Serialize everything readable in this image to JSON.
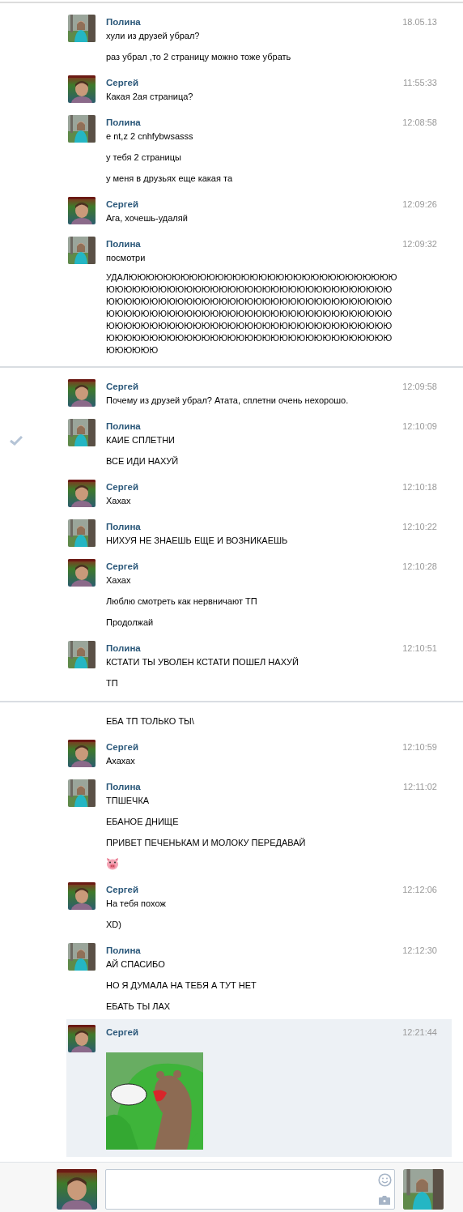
{
  "sections": [
    {
      "messages": [
        {
          "kind": "girl",
          "author": "Полина",
          "time": "18.05.13",
          "marked": false,
          "highlighted": false,
          "lines": [
            {
              "kind": "text",
              "text": "хули из друзей убрал?"
            },
            {
              "kind": "text",
              "text": "раз убрал ,то 2 страницу можно тоже убрать"
            }
          ]
        },
        {
          "kind": "boy",
          "author": "Сергей",
          "time": "11:55:33",
          "marked": false,
          "highlighted": false,
          "lines": [
            {
              "kind": "text",
              "text": "Какая 2ая страница?"
            }
          ]
        },
        {
          "kind": "girl",
          "author": "Полина",
          "time": "12:08:58",
          "marked": false,
          "highlighted": false,
          "lines": [
            {
              "kind": "text",
              "text": "e nt,z 2 cnhfybwsasss"
            },
            {
              "kind": "text",
              "text": "у тебя 2 страницы"
            },
            {
              "kind": "text",
              "text": "у меня в друзьях еще какая та"
            }
          ]
        },
        {
          "kind": "boy",
          "author": "Сергей",
          "time": "12:09:26",
          "marked": false,
          "highlighted": false,
          "lines": [
            {
              "kind": "text",
              "text": "Ага, хочешь-удаляй"
            }
          ]
        },
        {
          "kind": "girl",
          "author": "Полина",
          "time": "12:09:32",
          "marked": false,
          "highlighted": false,
          "lines": [
            {
              "kind": "text",
              "text": "посмотри"
            },
            {
              "kind": "long",
              "text": "УДАЛЮЮЮЮЮЮЮЮЮЮЮЮЮЮЮЮЮЮЮЮЮЮЮЮЮЮЮЮЮЮЮЮЮЮЮЮЮЮЮЮЮЮЮЮЮЮЮЮЮЮЮЮЮЮЮЮЮЮЮЮЮЮЮЮЮЮЮЮЮЮЮЮЮЮЮЮЮЮЮЮЮЮЮЮЮЮЮЮЮЮЮЮЮЮЮЮЮЮЮЮЮЮЮЮЮЮЮЮЮЮЮЮЮЮЮЮЮЮЮЮЮЮЮЮЮЮЮЮЮЮЮЮЮЮЮЮЮЮЮЮЮЮЮЮЮЮЮЮЮЮЮЮЮЮЮЮЮЮЮЮЮЮЮЮЮЮЮЮЮЮЮЮЮЮЮЮЮЮЮЮЮЮЮЮЮЮЮЮЮЮЮЮЮЮЮЮЮЮЮЮЮЮ"
            }
          ]
        }
      ]
    },
    {
      "messages": [
        {
          "kind": "boy",
          "author": "Сергей",
          "time": "12:09:58",
          "marked": false,
          "highlighted": false,
          "lines": [
            {
              "kind": "text",
              "text": "Почему из друзей убрал? Атата, сплетни очень нехорошо."
            }
          ]
        },
        {
          "kind": "girl",
          "author": "Полина",
          "time": "12:10:09",
          "marked": true,
          "highlighted": false,
          "lines": [
            {
              "kind": "text",
              "text": "КАИЕ СПЛЕТНИ"
            },
            {
              "kind": "text",
              "text": "ВСЕ ИДИ НАХУЙ"
            }
          ]
        },
        {
          "kind": "boy",
          "author": "Сергей",
          "time": "12:10:18",
          "marked": false,
          "highlighted": false,
          "lines": [
            {
              "kind": "text",
              "text": "Хахах"
            }
          ]
        },
        {
          "kind": "girl",
          "author": "Полина",
          "time": "12:10:22",
          "marked": false,
          "highlighted": false,
          "lines": [
            {
              "kind": "text",
              "text": "НИХУЯ НЕ ЗНАЕШЬ ЕЩЕ И ВОЗНИКАЕШЬ"
            }
          ]
        },
        {
          "kind": "boy",
          "author": "Сергей",
          "time": "12:10:28",
          "marked": false,
          "highlighted": false,
          "lines": [
            {
              "kind": "text",
              "text": "Хахах"
            },
            {
              "kind": "text",
              "text": "Люблю смотреть как нервничают ТП"
            },
            {
              "kind": "text",
              "text": "Продолжай"
            }
          ]
        },
        {
          "kind": "girl",
          "author": "Полина",
          "time": "12:10:51",
          "marked": false,
          "highlighted": false,
          "lines": [
            {
              "kind": "text",
              "text": "КСТАТИ ТЫ УВОЛЕН КСТАТИ ПОШЕЛ НАХУЙ"
            },
            {
              "kind": "text",
              "text": "ТП"
            }
          ]
        }
      ]
    },
    {
      "messages": [
        {
          "kind": "continuation",
          "marked": false,
          "highlighted": false,
          "lines": [
            {
              "kind": "text",
              "text": "ЕБА ТП ТОЛЬКО ТЫ\\"
            }
          ]
        },
        {
          "kind": "boy",
          "author": "Сергей",
          "time": "12:10:59",
          "marked": false,
          "highlighted": false,
          "lines": [
            {
              "kind": "text",
              "text": "Ахахах"
            }
          ]
        },
        {
          "kind": "girl",
          "author": "Полина",
          "time": "12:11:02",
          "marked": false,
          "highlighted": false,
          "lines": [
            {
              "kind": "text",
              "text": "ТПШЕЧКА"
            },
            {
              "kind": "text",
              "text": "ЕБАНОЕ ДНИЩЕ"
            },
            {
              "kind": "text",
              "text": "ПРИВЕТ ПЕЧЕНЬКАМ И МОЛОКУ ПЕРЕДАВАЙ"
            },
            {
              "kind": "emoji"
            }
          ]
        },
        {
          "kind": "boy",
          "author": "Сергей",
          "time": "12:12:06",
          "marked": false,
          "highlighted": false,
          "lines": [
            {
              "kind": "text",
              "text": "На тебя похож"
            },
            {
              "kind": "text",
              "text": "XD)"
            }
          ]
        },
        {
          "kind": "girl",
          "author": "Полина",
          "time": "12:12:30",
          "marked": false,
          "highlighted": false,
          "lines": [
            {
              "kind": "text",
              "text": "АЙ СПАСИБО"
            },
            {
              "kind": "text",
              "text": "НО Я ДУМАЛА НА ТЕБЯ А ТУТ НЕТ"
            },
            {
              "kind": "text",
              "text": "ЕБАТЬ ТЫ ЛАХ"
            }
          ]
        },
        {
          "kind": "boy",
          "author": "Сергей",
          "time": "12:21:44",
          "marked": false,
          "highlighted": true
        }
      ]
    }
  ],
  "composer": {
    "own_avatar": {
      "kind": "boy"
    },
    "contact_avatar": {
      "kind": "girl"
    }
  }
}
